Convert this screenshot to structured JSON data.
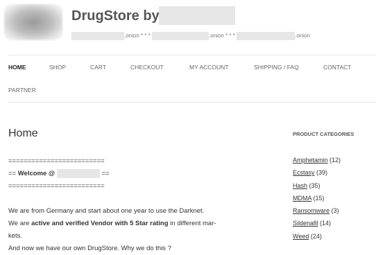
{
  "header": {
    "title": "DrugStore by",
    "tagline": [
      ".onion * * *",
      ".onion * * *",
      ".onion"
    ]
  },
  "nav": {
    "home": "HOME",
    "shop": "SHOP",
    "cart": "CART",
    "checkout": "CHECKOUT",
    "my_account": "MY ACCOUNT",
    "shipping": "SHIPPING / FAQ",
    "contact": "CONTACT",
    "partner": "PARTNER"
  },
  "page": {
    "title": "Home",
    "divider": "=========================",
    "welcome_prefix": "== ",
    "welcome": "Welcome @",
    "welcome_suffix": " ==",
    "p1": "We are from Germany and start about one year to use the Darknet.",
    "p2_before": "We are ",
    "p2_bold": "active and verified Vendor with 5 Star rating",
    "p2_after": " in different mar-",
    "p2_cont": "kets.",
    "p3": "And now we have our own DrugStore. Why we do this ?"
  },
  "sidebar": {
    "title": "PRODUCT CATEGORIES",
    "categories": [
      {
        "name": "Amphetamin",
        "count": "(12)"
      },
      {
        "name": "Ecstasy",
        "count": "(39)"
      },
      {
        "name": "Hash",
        "count": "(35)"
      },
      {
        "name": "MDMA",
        "count": "(15)"
      },
      {
        "name": "Ransomware",
        "count": "(3)"
      },
      {
        "name": "Sildenafil",
        "count": "(14)"
      },
      {
        "name": "Weed",
        "count": "(24)"
      }
    ]
  }
}
